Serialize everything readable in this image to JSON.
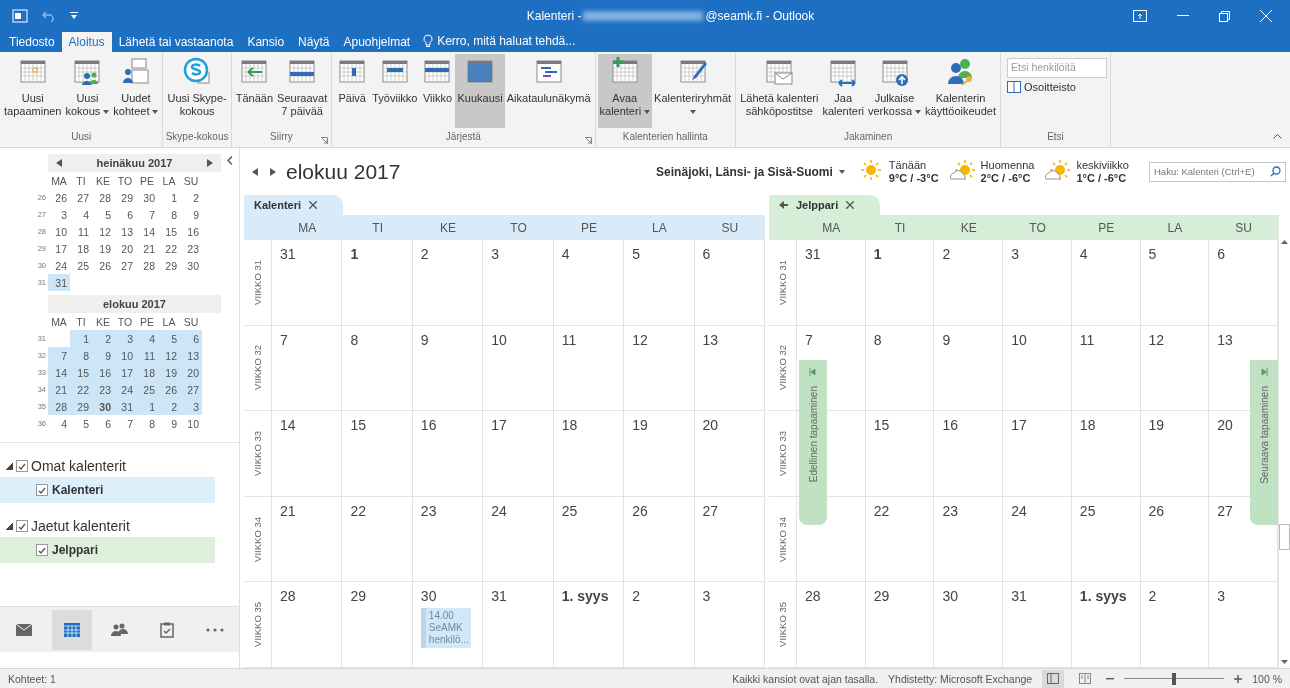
{
  "window": {
    "title_prefix": "Kalenteri - ",
    "title_suffix": "@seamk.fi - Outlook"
  },
  "menu_tabs": [
    {
      "label": "Tiedosto",
      "selected": false
    },
    {
      "label": "Aloitus",
      "selected": true
    },
    {
      "label": "Lähetä tai vastaanota",
      "selected": false
    },
    {
      "label": "Kansio",
      "selected": false
    },
    {
      "label": "Näytä",
      "selected": false
    },
    {
      "label": "Apuohjelmat",
      "selected": false
    }
  ],
  "tell_me": "Kerro, mitä haluat tehdä...",
  "ribbon_groups": [
    {
      "kind": "buttons",
      "label": "Uusi",
      "buttons": [
        {
          "kind": "calendar",
          "lines": [
            "Uusi",
            "tapaaminen"
          ],
          "selected": false
        },
        {
          "kind": "meeting",
          "lines": [
            "Uusi",
            "kokous"
          ],
          "dropdown": true,
          "selected": false
        },
        {
          "kind": "items",
          "lines": [
            "Uudet",
            "kohteet"
          ],
          "dropdown": true,
          "selected": false
        }
      ]
    },
    {
      "kind": "buttons",
      "label": "Skype-kokous",
      "buttons": [
        {
          "kind": "skype",
          "lines": [
            "Uusi Skype-",
            "kokous"
          ],
          "selected": false
        }
      ]
    },
    {
      "kind": "buttons",
      "label": "Siirry",
      "launcher": true,
      "buttons": [
        {
          "kind": "today",
          "lines": [
            "Tänään"
          ],
          "selected": false
        },
        {
          "kind": "next7",
          "lines": [
            "Seuraavat",
            "7 päivää"
          ],
          "selected": false
        }
      ]
    },
    {
      "kind": "buttons",
      "label": "Järjestä",
      "launcher": true,
      "buttons": [
        {
          "kind": "day",
          "lines": [
            "Päivä"
          ],
          "selected": false
        },
        {
          "kind": "workweek",
          "lines": [
            "Työviikko"
          ],
          "selected": false
        },
        {
          "kind": "week",
          "lines": [
            "Viikko"
          ],
          "selected": false
        },
        {
          "kind": "month",
          "lines": [
            "Kuukausi"
          ],
          "selected": true
        },
        {
          "kind": "schedule",
          "lines": [
            "Aikataulunäkymä"
          ],
          "selected": false
        }
      ]
    },
    {
      "kind": "buttons",
      "label": "Kalenterien hallinta",
      "buttons": [
        {
          "kind": "open",
          "lines": [
            "Avaa",
            "kalenteri"
          ],
          "dropdown": true,
          "selected": true
        },
        {
          "kind": "groups",
          "lines": [
            "Kalenteriryhmät"
          ],
          "dropdown": true,
          "selected": false
        }
      ]
    },
    {
      "kind": "buttons",
      "label": "Jakaminen",
      "buttons": [
        {
          "kind": "email",
          "lines": [
            "Lähetä kalenteri",
            "sähköpostitse"
          ],
          "selected": false
        },
        {
          "kind": "share",
          "lines": [
            "Jaa",
            "kalenteri"
          ],
          "selected": false
        },
        {
          "kind": "publish",
          "lines": [
            "Julkaise",
            "verkossa"
          ],
          "dropdown": true,
          "selected": false
        },
        {
          "kind": "permissions",
          "lines": [
            "Kalenterin",
            "käyttöoikeudet"
          ],
          "selected": false
        }
      ]
    },
    {
      "kind": "search",
      "label": "Etsi",
      "placeholder": "Etsi henkilöitä",
      "button": "Osoitteisto"
    }
  ],
  "mini_calendars": [
    {
      "title": "heinäkuu 2017",
      "nav": true,
      "weekdays": [
        "MA",
        "TI",
        "KE",
        "TO",
        "PE",
        "LA",
        "SU"
      ],
      "weeks": [
        {
          "number": "26",
          "days": [
            {
              "label": "26",
              "selected": false
            },
            {
              "label": "27",
              "selected": false
            },
            {
              "label": "28",
              "selected": false
            },
            {
              "label": "29",
              "selected": false
            },
            {
              "label": "30",
              "selected": false
            },
            {
              "label": "1",
              "selected": false
            },
            {
              "label": "2",
              "selected": false
            }
          ]
        },
        {
          "number": "27",
          "days": [
            {
              "label": "3",
              "selected": false
            },
            {
              "label": "4",
              "selected": false
            },
            {
              "label": "5",
              "selected": false
            },
            {
              "label": "6",
              "selected": false
            },
            {
              "label": "7",
              "selected": false
            },
            {
              "label": "8",
              "selected": false
            },
            {
              "label": "9",
              "selected": false
            }
          ]
        },
        {
          "number": "28",
          "days": [
            {
              "label": "10",
              "selected": false
            },
            {
              "label": "11",
              "selected": false
            },
            {
              "label": "12",
              "selected": false
            },
            {
              "label": "13",
              "selected": false
            },
            {
              "label": "14",
              "selected": false
            },
            {
              "label": "15",
              "selected": false
            },
            {
              "label": "16",
              "selected": false
            }
          ]
        },
        {
          "number": "29",
          "days": [
            {
              "label": "17",
              "selected": false
            },
            {
              "label": "18",
              "selected": false
            },
            {
              "label": "19",
              "selected": false
            },
            {
              "label": "20",
              "selected": false
            },
            {
              "label": "21",
              "selected": false
            },
            {
              "label": "22",
              "selected": false
            },
            {
              "label": "23",
              "selected": false
            }
          ]
        },
        {
          "number": "30",
          "days": [
            {
              "label": "24",
              "selected": false
            },
            {
              "label": "25",
              "selected": false
            },
            {
              "label": "26",
              "selected": false
            },
            {
              "label": "27",
              "selected": false
            },
            {
              "label": "28",
              "selected": false
            },
            {
              "label": "29",
              "selected": false
            },
            {
              "label": "30",
              "selected": false
            }
          ]
        },
        {
          "number": "31",
          "days": [
            {
              "label": "31",
              "selected": true
            }
          ]
        }
      ]
    },
    {
      "title": "elokuu 2017",
      "weekdays": [
        "MA",
        "TI",
        "KE",
        "TO",
        "PE",
        "LA",
        "SU"
      ],
      "weeks": [
        {
          "number": "31",
          "days": [
            {
              "label": "1",
              "selected": true
            },
            {
              "label": "2",
              "selected": true
            },
            {
              "label": "3",
              "selected": true
            },
            {
              "label": "4",
              "selected": true
            },
            {
              "label": "5",
              "selected": true
            },
            {
              "label": "6",
              "selected": true
            }
          ]
        },
        {
          "number": "32",
          "days": [
            {
              "label": "7",
              "selected": true
            },
            {
              "label": "8",
              "selected": true
            },
            {
              "label": "9",
              "selected": true
            },
            {
              "label": "10",
              "selected": true
            },
            {
              "label": "11",
              "selected": true
            },
            {
              "label": "12",
              "selected": true
            },
            {
              "label": "13",
              "selected": true
            }
          ]
        },
        {
          "number": "33",
          "days": [
            {
              "label": "14",
              "selected": true
            },
            {
              "label": "15",
              "selected": true
            },
            {
              "label": "16",
              "selected": true
            },
            {
              "label": "17",
              "selected": true
            },
            {
              "label": "18",
              "selected": true
            },
            {
              "label": "19",
              "selected": true
            },
            {
              "label": "20",
              "selected": true
            }
          ]
        },
        {
          "number": "34",
          "days": [
            {
              "label": "21",
              "selected": true
            },
            {
              "label": "22",
              "selected": true
            },
            {
              "label": "23",
              "selected": true
            },
            {
              "label": "24",
              "selected": true
            },
            {
              "label": "25",
              "selected": true
            },
            {
              "label": "26",
              "selected": true
            },
            {
              "label": "27",
              "selected": true
            }
          ]
        },
        {
          "number": "35",
          "days": [
            {
              "label": "28",
              "selected": true
            },
            {
              "label": "29",
              "selected": true
            },
            {
              "label": "30",
              "selected": true,
              "bold": true
            },
            {
              "label": "31",
              "selected": true
            },
            {
              "label": "1",
              "selected": true
            },
            {
              "label": "2",
              "selected": true
            },
            {
              "label": "3",
              "selected": true
            }
          ]
        },
        {
          "number": "36",
          "days": [
            {
              "label": "4",
              "selected": false
            },
            {
              "label": "5",
              "selected": false
            },
            {
              "label": "6",
              "selected": false
            },
            {
              "label": "7",
              "selected": false
            },
            {
              "label": "8",
              "selected": false
            },
            {
              "label": "9",
              "selected": false
            },
            {
              "label": "10",
              "selected": false
            }
          ]
        }
      ]
    }
  ],
  "folder_groups": [
    {
      "label": "Omat kalenterit",
      "checked": true,
      "expanded": true,
      "items": [
        {
          "label": "Kalenteri",
          "checked": true,
          "color": "#ddeffb"
        }
      ]
    },
    {
      "label": "Jaetut kalenterit",
      "checked": true,
      "expanded": true,
      "items": [
        {
          "label": "Jelppari",
          "checked": true,
          "color": "#def0dc"
        }
      ]
    }
  ],
  "nav_bar": [
    {
      "kind": "mail",
      "selected": false
    },
    {
      "kind": "calendar",
      "selected": true
    },
    {
      "kind": "people",
      "selected": false
    },
    {
      "kind": "tasks",
      "selected": false
    },
    {
      "kind": "more",
      "selected": false
    }
  ],
  "header": {
    "month": "elokuu 2017",
    "location": "Seinäjoki, Länsi- ja Sisä-Suomi",
    "weather": [
      {
        "day": "Tänään",
        "temp": "9°C / -3°C",
        "kind": "sunny"
      },
      {
        "day": "Huomenna",
        "temp": "2°C / -6°C",
        "kind": "partly"
      },
      {
        "day": "keskiviikko",
        "temp": "1°C / -6°C",
        "kind": "partly"
      }
    ],
    "search_placeholder": "Haku: Kalenteri (Ctrl+E)"
  },
  "panes": [
    {
      "tab": "Kalenteri",
      "color": "#d9ebf9",
      "weekdays": [
        "MA",
        "TI",
        "KE",
        "TO",
        "PE",
        "LA",
        "SU"
      ],
      "weeks": [
        {
          "label": "VIIKKO 31",
          "days": [
            {
              "label": "31"
            },
            {
              "label": "1",
              "bold": true
            },
            {
              "label": "2"
            },
            {
              "label": "3"
            },
            {
              "label": "4"
            },
            {
              "label": "5"
            },
            {
              "label": "6"
            }
          ]
        },
        {
          "label": "VIIKKO 32",
          "days": [
            {
              "label": "7"
            },
            {
              "label": "8"
            },
            {
              "label": "9"
            },
            {
              "label": "10"
            },
            {
              "label": "11"
            },
            {
              "label": "12"
            },
            {
              "label": "13"
            }
          ]
        },
        {
          "label": "VIIKKO 33",
          "days": [
            {
              "label": "14"
            },
            {
              "label": "15"
            },
            {
              "label": "16"
            },
            {
              "label": "17"
            },
            {
              "label": "18"
            },
            {
              "label": "19"
            },
            {
              "label": "20"
            }
          ]
        },
        {
          "label": "VIIKKO 34",
          "days": [
            {
              "label": "21"
            },
            {
              "label": "22"
            },
            {
              "label": "23"
            },
            {
              "label": "24"
            },
            {
              "label": "25"
            },
            {
              "label": "26"
            },
            {
              "label": "27"
            }
          ]
        },
        {
          "label": "VIIKKO 35",
          "days": [
            {
              "label": "28"
            },
            {
              "label": "29"
            },
            {
              "label": "30",
              "events": [
                {
                  "time": "14.00",
                  "subject": "SeAMK henkilö..."
                }
              ]
            },
            {
              "label": "31"
            },
            {
              "label": "1. syys",
              "bold": true
            },
            {
              "label": "2"
            },
            {
              "label": "3"
            }
          ]
        }
      ]
    },
    {
      "tab": "Jelppari",
      "color": "#d6edd7",
      "overlay_arrow": true,
      "weekdays": [
        "MA",
        "TI",
        "KE",
        "TO",
        "PE",
        "LA",
        "SU"
      ],
      "side_tabs": [
        {
          "label": "Edellinen tapaaminen",
          "kind": "previous"
        },
        {
          "label": "Seuraava tapaaminen",
          "kind": "next"
        }
      ],
      "weeks": [
        {
          "label": "VIIKKO 31",
          "days": [
            {
              "label": "31"
            },
            {
              "label": "1",
              "bold": true
            },
            {
              "label": "2"
            },
            {
              "label": "3"
            },
            {
              "label": "4"
            },
            {
              "label": "5"
            },
            {
              "label": "6"
            }
          ]
        },
        {
          "label": "VIIKKO 32",
          "days": [
            {
              "label": "7"
            },
            {
              "label": "8"
            },
            {
              "label": "9"
            },
            {
              "label": "10"
            },
            {
              "label": "11"
            },
            {
              "label": "12"
            },
            {
              "label": "13"
            }
          ]
        },
        {
          "label": "VIIKKO 33",
          "days": [
            {
              "label": "15"
            },
            {
              "label": "16"
            },
            {
              "label": "17"
            },
            {
              "label": "18"
            },
            {
              "label": "19"
            },
            {
              "label": "20"
            }
          ]
        },
        {
          "label": "VIIKKO 34",
          "days": [
            {
              "label": "22"
            },
            {
              "label": "23"
            },
            {
              "label": "24"
            },
            {
              "label": "25"
            },
            {
              "label": "26"
            },
            {
              "label": "27"
            }
          ]
        },
        {
          "label": "VIIKKO 35",
          "days": [
            {
              "label": "28"
            },
            {
              "label": "29"
            },
            {
              "label": "30"
            },
            {
              "label": "31"
            },
            {
              "label": "1. syys",
              "bold": true
            },
            {
              "label": "2"
            },
            {
              "label": "3"
            }
          ]
        }
      ]
    }
  ],
  "status_bar": {
    "items": "Kohteet: 1",
    "sync": "Kaikki kansiot ovat ajan tasalla.",
    "connection": "Yhdistetty: Microsoft Exchange",
    "zoom": {
      "level": 0.5,
      "reading": "100 %"
    }
  }
}
